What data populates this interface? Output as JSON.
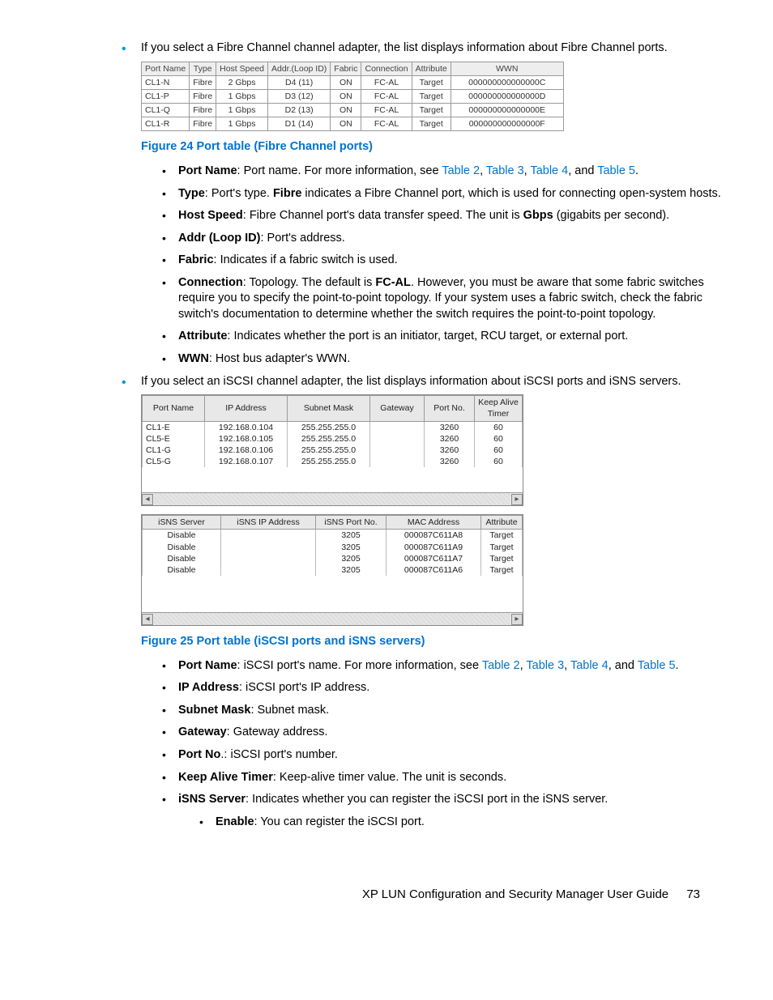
{
  "intro_fc": "If you select a Fibre Channel channel adapter, the list displays information about Fibre Channel ports.",
  "fc_table": {
    "headers": [
      "Port Name",
      "Type",
      "Host Speed",
      "Addr.(Loop ID)",
      "Fabric",
      "Connection",
      "Attribute",
      "WWN"
    ],
    "rows": [
      [
        "CL1-N",
        "Fibre",
        "2 Gbps",
        "D4 (11)",
        "ON",
        "FC-AL",
        "Target",
        "000000000000000C"
      ],
      [
        "CL1-P",
        "Fibre",
        "1 Gbps",
        "D3 (12)",
        "ON",
        "FC-AL",
        "Target",
        "000000000000000D"
      ],
      [
        "CL1-Q",
        "Fibre",
        "1 Gbps",
        "D2 (13)",
        "ON",
        "FC-AL",
        "Target",
        "000000000000000E"
      ],
      [
        "CL1-R",
        "Fibre",
        "1 Gbps",
        "D1 (14)",
        "ON",
        "FC-AL",
        "Target",
        "000000000000000F"
      ]
    ]
  },
  "fig24": "Figure 24 Port table (Fibre Channel ports)",
  "fc_defs": {
    "port_name_b": "Port Name",
    "port_name_t1": ": Port name. For more information, see ",
    "links": {
      "t2": "Table 2",
      "t3": "Table 3",
      "t4": "Table 4",
      "t5": "Table 5"
    },
    "sep_comma": ", ",
    "sep_and": ", and ",
    "period": ".",
    "type_b": "Type",
    "type_t1": ": Port's type. ",
    "type_b2": "Fibre",
    "type_t2": " indicates a Fibre Channel port, which is used for connecting open-system hosts.",
    "hs_b": "Host Speed",
    "hs_t1": ": Fibre Channel port's data transfer speed. The unit is ",
    "hs_b2": "Gbps",
    "hs_t2": " (gigabits per second).",
    "addr_b": "Addr (Loop ID)",
    "addr_t": ": Port's address.",
    "fabric_b": "Fabric",
    "fabric_t": ": Indicates if a fabric switch is used.",
    "conn_b": "Connection",
    "conn_t1": ": Topology. The default is ",
    "conn_b2": "FC-AL",
    "conn_t2": ". However, you must be aware that some fabric switches require you to specify the point-to-point topology. If your system uses a fabric switch, check the fabric switch's documentation to determine whether the switch requires the point-to-point topology.",
    "attr_b": "Attribute",
    "attr_t": ": Indicates whether the port is an initiator, target, RCU target, or external port.",
    "wwn_b": "WWN",
    "wwn_t": ": Host bus adapter's WWN."
  },
  "intro_iscsi": "If you select an iSCSI channel adapter, the list displays information about iSCSI ports and iSNS servers.",
  "iscsi_table": {
    "headers": [
      "Port Name",
      "IP Address",
      "Subnet Mask",
      "Gateway",
      "Port No.",
      "Keep Alive Timer"
    ],
    "rows": [
      [
        "CL1-E",
        "192.168.0.104",
        "255.255.255.0",
        "",
        "3260",
        "60"
      ],
      [
        "CL5-E",
        "192.168.0.105",
        "255.255.255.0",
        "",
        "3260",
        "60"
      ],
      [
        "CL1-G",
        "192.168.0.106",
        "255.255.255.0",
        "",
        "3260",
        "60"
      ],
      [
        "CL5-G",
        "192.168.0.107",
        "255.255.255.0",
        "",
        "3260",
        "60"
      ]
    ]
  },
  "isns_table": {
    "headers": [
      "iSNS Server",
      "iSNS IP Address",
      "iSNS Port No.",
      "MAC Address",
      "Attribute"
    ],
    "rows": [
      [
        "Disable",
        "",
        "3205",
        "000087C611A8",
        "Target"
      ],
      [
        "Disable",
        "",
        "3205",
        "000087C611A9",
        "Target"
      ],
      [
        "Disable",
        "",
        "3205",
        "000087C611A7",
        "Target"
      ],
      [
        "Disable",
        "",
        "3205",
        "000087C611A6",
        "Target"
      ]
    ]
  },
  "fig25": "Figure 25 Port table (iSCSI ports and iSNS servers)",
  "iscsi_defs": {
    "pn_b": "Port Name",
    "pn_t1": ": iSCSI port's name. For more information, see ",
    "ip_b": "IP Address",
    "ip_t": ": iSCSI port's IP address.",
    "sm_b": "Subnet Mask",
    "sm_t": ": Subnet mask.",
    "gw_b": "Gateway",
    "gw_t": ": Gateway address.",
    "pno_b": "Port No",
    "pno_t": ".: iSCSI port's number.",
    "kat_b": "Keep Alive Timer",
    "kat_t": ": Keep-alive timer value. The unit is seconds.",
    "isns_b": "iSNS Server",
    "isns_t": ": Indicates whether you can register the iSCSI port in the iSNS server.",
    "en_b": "Enable",
    "en_t": ": You can register the iSCSI port."
  },
  "footer_title": "XP LUN Configuration and Security Manager User Guide",
  "page_no": "73",
  "arrows": {
    "left": "◂",
    "right": "▸"
  }
}
